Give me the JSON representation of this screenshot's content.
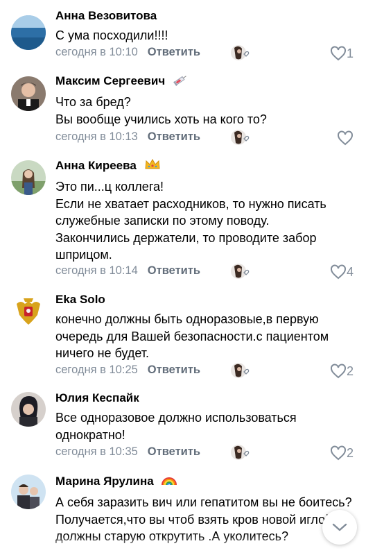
{
  "comments": [
    {
      "name": "Анна Везовитова",
      "text": "С ума посходили!!!!",
      "time": "сегодня в 10:10",
      "reply": "Ответить",
      "likes": "1",
      "badge": ""
    },
    {
      "name": "Максим Сергеевич",
      "text": "Что за бред?\nВы вообще учились хоть на кого то?",
      "time": "сегодня в 10:13",
      "reply": "Ответить",
      "likes": "",
      "badge": "syringe-icon"
    },
    {
      "name": "Анна Киреева",
      "text": "Это пи...ц коллега!\nЕсли не хватает расходников, то нужно писать служебные записки по этому поводу.\nЗакончились держатели, то проводите забор шприцом.",
      "time": "сегодня в 10:14",
      "reply": "Ответить",
      "likes": "4",
      "badge": "crown-icon"
    },
    {
      "name": "Eka Solo",
      "text": "конечно должны быть одноразовые,в первую очередь для Вашей безопасности.с пациентом ничего не будет.",
      "time": "сегодня в 10:25",
      "reply": "Ответить",
      "likes": "2",
      "badge": ""
    },
    {
      "name": "Юлия Кеспайк",
      "text": "Все одноразовое должно использоваться однократно!",
      "time": "сегодня в 10:35",
      "reply": "Ответить",
      "likes": "2",
      "badge": ""
    },
    {
      "name": "Марина Ярулина",
      "text": "А себя заразить вич или гепатитом вы не боитесь?Получается,что вы чтоб взять кров новой иглой должны старую открутить .А уколитесь?",
      "badge": "rainbow-icon"
    }
  ]
}
